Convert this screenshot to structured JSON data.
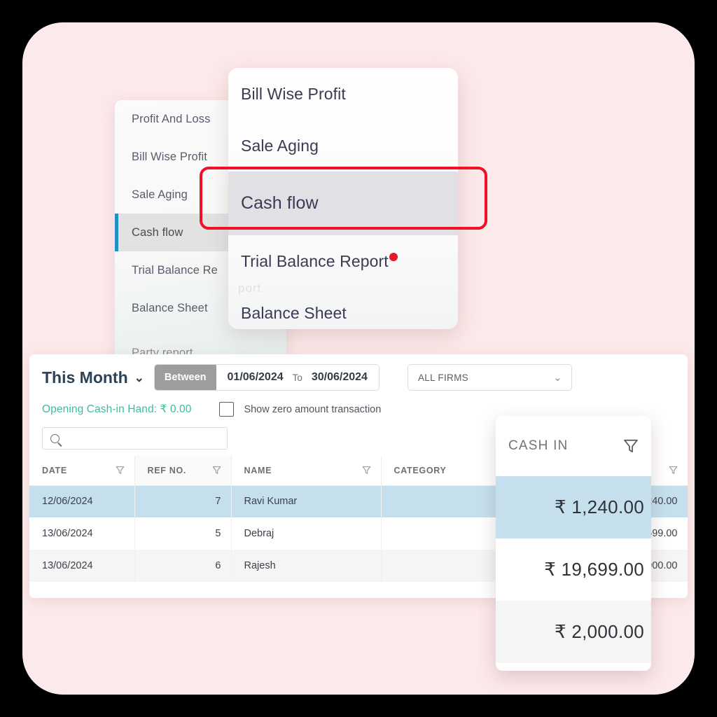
{
  "theme": {
    "backdrop": "#000000",
    "card_pink": "#fce9e9",
    "accent_red": "#f01126",
    "accent_teal": "#3cbd9e",
    "row_selected": "#c5e0ec",
    "active_bar": "#1f8fc4"
  },
  "sidebar": {
    "items": [
      {
        "label": "Profit And Loss",
        "active": false
      },
      {
        "label": "Bill Wise Profit",
        "active": false
      },
      {
        "label": "Sale Aging",
        "active": false
      },
      {
        "label": "Cash flow",
        "active": true
      },
      {
        "label": "Trial Balance Re",
        "active": false
      },
      {
        "label": "Balance Sheet",
        "active": false
      },
      {
        "label": "Party report",
        "active": false
      }
    ]
  },
  "zoom_menu": {
    "items": [
      {
        "label": "Bill Wise Profit",
        "selected": false,
        "badge": false
      },
      {
        "label": "Sale Aging",
        "selected": false,
        "badge": false
      },
      {
        "label": "Cash flow",
        "selected": true,
        "badge": false
      },
      {
        "label": "Trial Balance Report",
        "selected": false,
        "badge": true
      },
      {
        "label": "Balance Sheet",
        "selected": false,
        "badge": false
      }
    ],
    "ghost_label": "port"
  },
  "report": {
    "period_label": "This Month",
    "period_chevron": "⌄",
    "between_label": "Between",
    "date_from": "01/06/2024",
    "date_to_label": "To",
    "date_to": "30/06/2024",
    "firm_selected": "ALL FIRMS",
    "firm_chevron": "⌄",
    "opening_balance": "Opening Cash-in Hand: ₹ 0.00",
    "show_zero_label": "Show zero amount transaction",
    "show_zero_checked": false,
    "search_value": "",
    "search_placeholder": "",
    "columns": [
      {
        "key": "date",
        "label": "DATE",
        "filter": true
      },
      {
        "key": "ref",
        "label": "REF NO.",
        "filter": true
      },
      {
        "key": "name",
        "label": "NAME",
        "filter": true
      },
      {
        "key": "category",
        "label": "CATEGORY",
        "filter": false
      },
      {
        "key": "cashin",
        "label": "CASH IN",
        "filter": true
      }
    ],
    "rows": [
      {
        "date": "12/06/2024",
        "ref": "7",
        "name": "Ravi Kumar",
        "category": "",
        "cashin": ",240.00",
        "state": "selected"
      },
      {
        "date": "13/06/2024",
        "ref": "5",
        "name": "Debraj",
        "category": "",
        "cashin": ",699.00",
        "state": "white"
      },
      {
        "date": "13/06/2024",
        "ref": "6",
        "name": "Rajesh",
        "category": "",
        "cashin": ",000.00",
        "state": "grey"
      }
    ]
  },
  "cashin_overlay": {
    "header_label": "CASH IN",
    "rows": [
      {
        "value": "₹ 1,240.00",
        "state": "sel"
      },
      {
        "value": "₹ 19,699.00",
        "state": "white"
      },
      {
        "value": "₹ 2,000.00",
        "state": "grey"
      }
    ]
  }
}
